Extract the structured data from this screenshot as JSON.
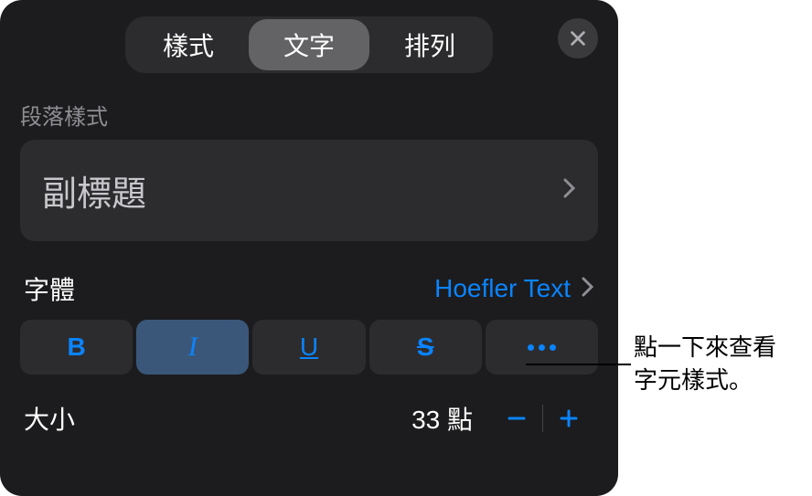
{
  "tabs": {
    "style": "樣式",
    "text": "文字",
    "arrange": "排列"
  },
  "paragraph_style": {
    "label": "段落樣式",
    "value": "副標題"
  },
  "font": {
    "label": "字體",
    "value": "Hoefler Text"
  },
  "format": {
    "bold": "B",
    "italic": "I",
    "underline": "U",
    "strike": "S"
  },
  "size": {
    "label": "大小",
    "value": "33 點"
  },
  "callout": {
    "line1": "點一下來查看",
    "line2": "字元樣式。"
  }
}
